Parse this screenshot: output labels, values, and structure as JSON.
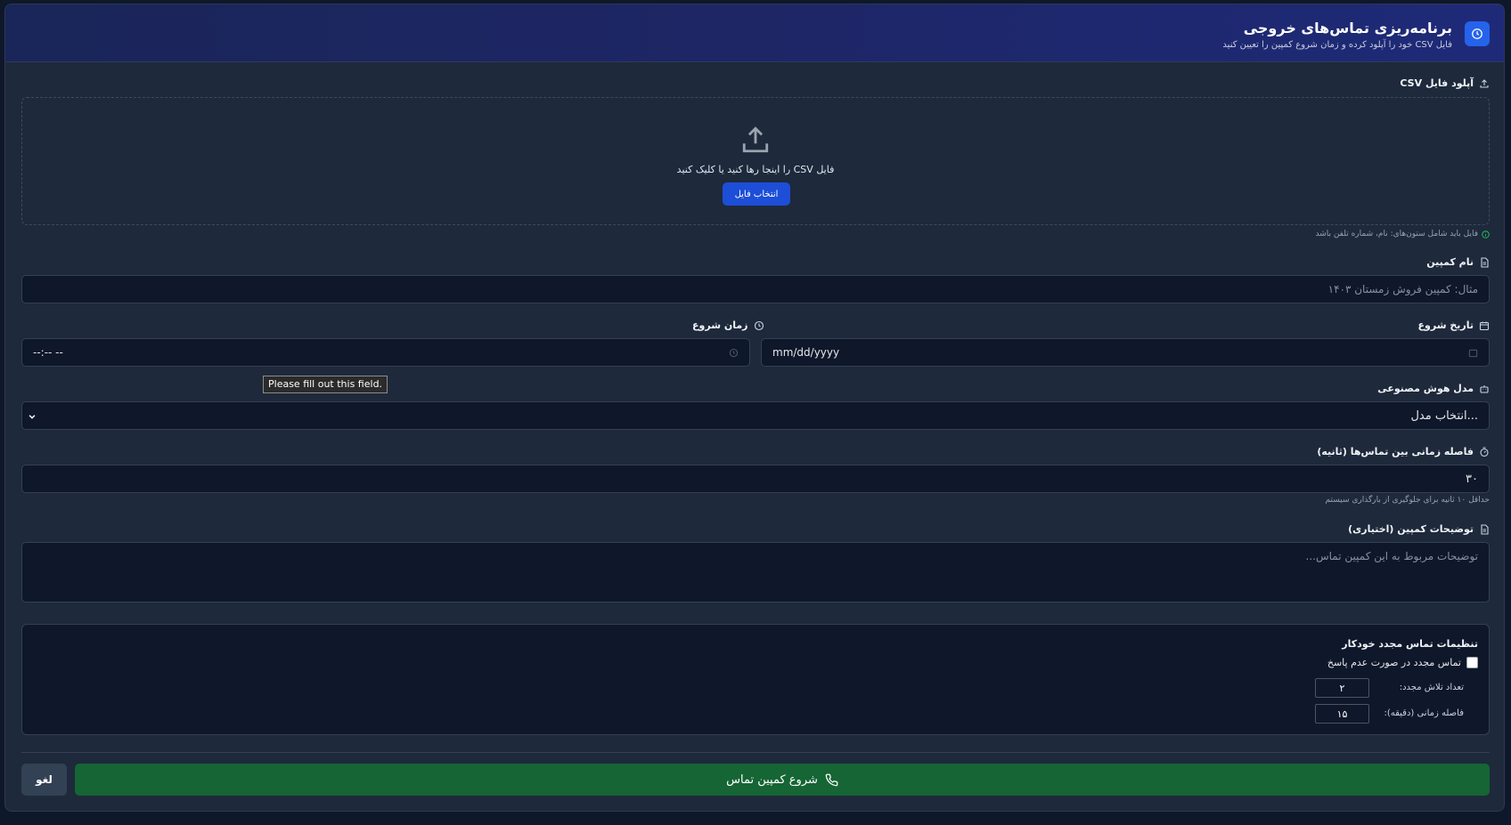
{
  "header": {
    "title": "برنامه‌ریزی تماس‌های خروجی",
    "subtitle": "فایل CSV خود را آپلود کرده و زمان شروع کمپین را تعیین کنید",
    "icon": "clock-icon"
  },
  "upload": {
    "label": "آپلود فایل CSV",
    "drop_text": "فایل CSV را اینجا رها کنید یا کلیک کنید",
    "button_label": "انتخاب فایل",
    "hint": "فایل باید شامل ستون‌های: نام، شماره تلفن باشد"
  },
  "campaign_name": {
    "label": "نام کمپین",
    "placeholder": "مثال: کمپین فروش زمستان ۱۴۰۳"
  },
  "start_date": {
    "label": "تاریخ شروع",
    "value": "mm/dd/yyyy"
  },
  "start_time": {
    "label": "زمان شروع",
    "value": "--:-- --",
    "validation_tooltip": "Please fill out this field."
  },
  "ai_model": {
    "label": "مدل هوش مصنوعی",
    "selected": "انتخاب مدل..."
  },
  "interval": {
    "label": "فاصله زمانی بین تماس‌ها (ثانیه)",
    "value": "۳۰",
    "hint": "حداقل ۱۰ ثانیه برای جلوگیری از بارگذاری سیستم"
  },
  "description": {
    "label": "توضیحات کمپین (اختیاری)",
    "placeholder": "توضیحات مربوط به این کمپین تماس..."
  },
  "retry": {
    "title": "تنظیمات تماس مجدد خودکار",
    "checkbox_label": "تماس مجدد در صورت عدم پاسخ",
    "checked": false,
    "attempts_label": "تعداد تلاش مجدد:",
    "attempts_value": "۲",
    "delay_label": "فاصله زمانی (دقیقه):",
    "delay_value": "۱۵"
  },
  "actions": {
    "start_label": "شروع کمپین تماس",
    "cancel_label": "لغو"
  },
  "colors": {
    "accent": "#2563eb",
    "start_button": "#166534",
    "background": "#0f172a"
  }
}
